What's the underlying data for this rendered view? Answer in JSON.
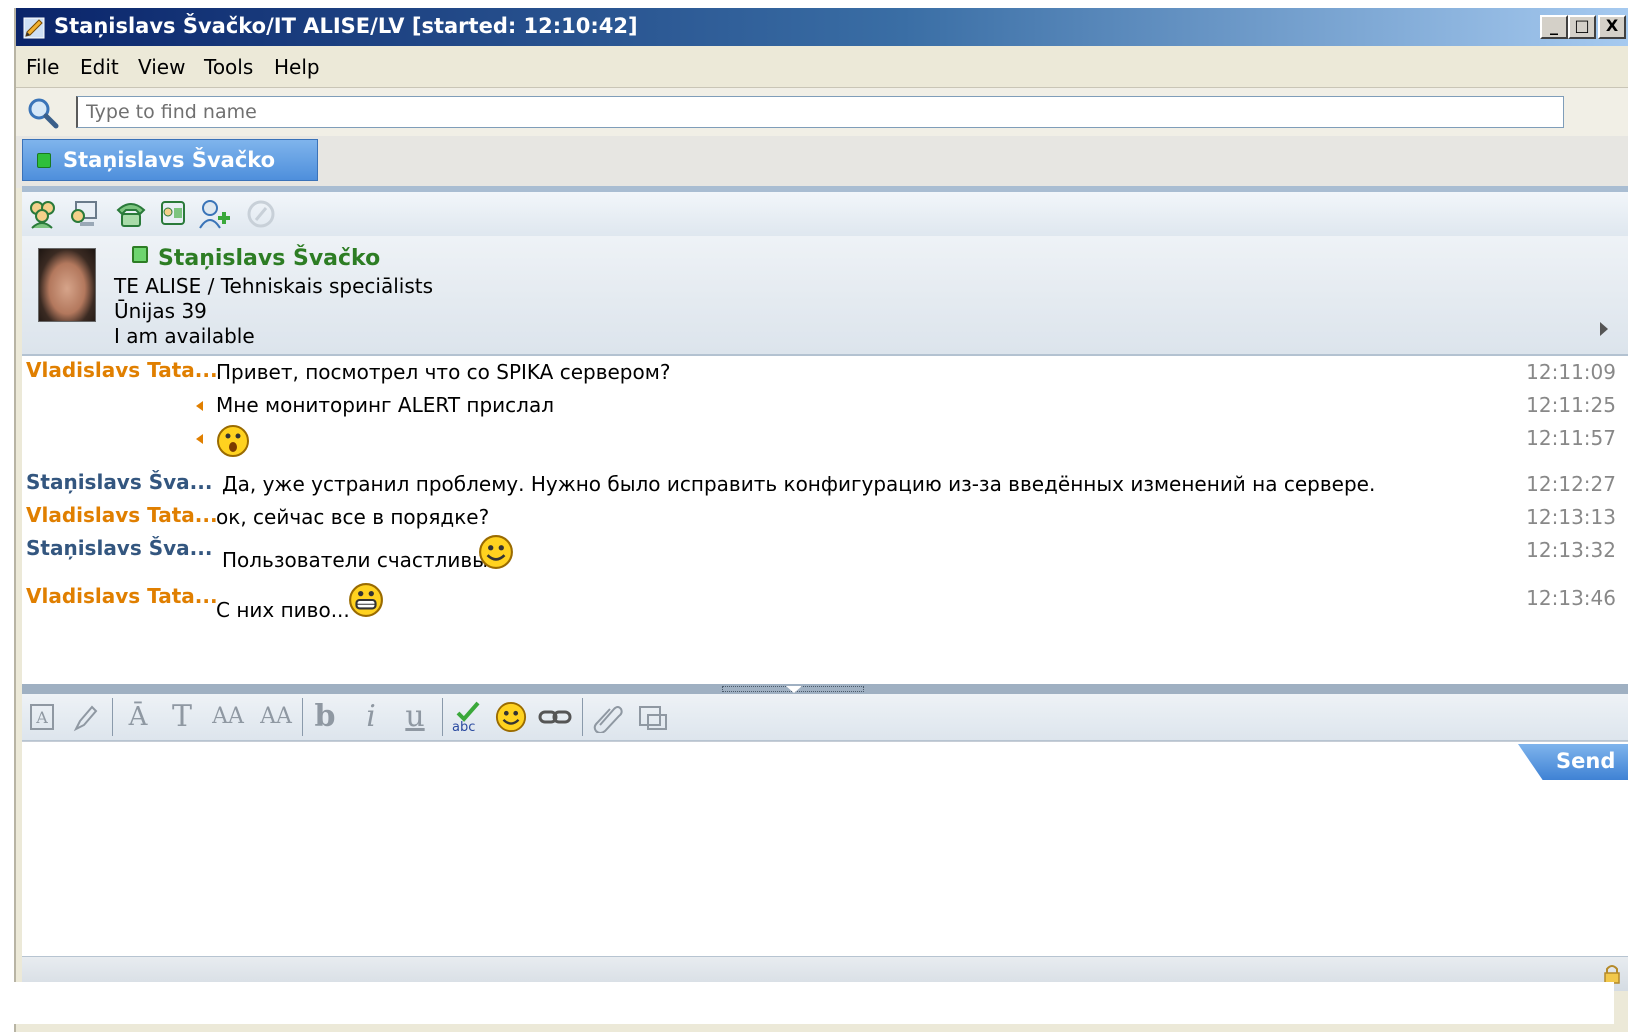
{
  "window": {
    "title": "Staņislavs Švačko/IT ALISE/LV [started: 12:10:42]",
    "controls": {
      "minimize": "_",
      "maximize": "□",
      "close": "X"
    }
  },
  "menu": [
    "File",
    "Edit",
    "View",
    "Tools",
    "Help"
  ],
  "search": {
    "placeholder": "Type to find name",
    "value": ""
  },
  "tab": {
    "label": "Staņislavs Švačko",
    "status_color": "#2fbf3b"
  },
  "contact": {
    "name": "Staņislavs Švačko",
    "department": "TE ALISE / Tehniskais speciālists",
    "address": "Ūnijas 39",
    "status": "I am available"
  },
  "messages": [
    {
      "sender": "Vladislavs Tata...",
      "sender_color": "orange",
      "text": "Привет, посмотрел что со SPIKA сервером?",
      "time": "12:11:09",
      "emoticon": null
    },
    {
      "sender": "",
      "sender_color": "orange",
      "text": "Мне мониторинг ALERT прислал",
      "time": "12:11:25",
      "emoticon": null
    },
    {
      "sender": "",
      "sender_color": "orange",
      "text": "",
      "time": "12:11:57",
      "emoticon": "surprised"
    },
    {
      "sender": "Staņislavs Šva...",
      "sender_color": "blue",
      "text": "Да, уже устранил проблему. Нужно было исправить конфигурацию из-за введённых изменений на сервере.",
      "time": "12:12:27",
      "emoticon": null
    },
    {
      "sender": "Vladislavs Tata...",
      "sender_color": "orange",
      "text": "ок, сейчас все в порядке?",
      "time": "12:13:13",
      "emoticon": null
    },
    {
      "sender": "Staņislavs Šva...",
      "sender_color": "blue",
      "text": "Пользователи счастливы",
      "time": "12:13:32",
      "emoticon": "smile"
    },
    {
      "sender": "Vladislavs Tata...",
      "sender_color": "orange",
      "text": "С них пиво...",
      "time": "12:13:46",
      "emoticon": "grin"
    }
  ],
  "compose": {
    "send_label": "Send",
    "value": ""
  },
  "colors": {
    "accent": "#4e8fdc",
    "orange_sender": "#e07f00",
    "blue_sender": "#33567f",
    "online": "#2fbf3b"
  }
}
